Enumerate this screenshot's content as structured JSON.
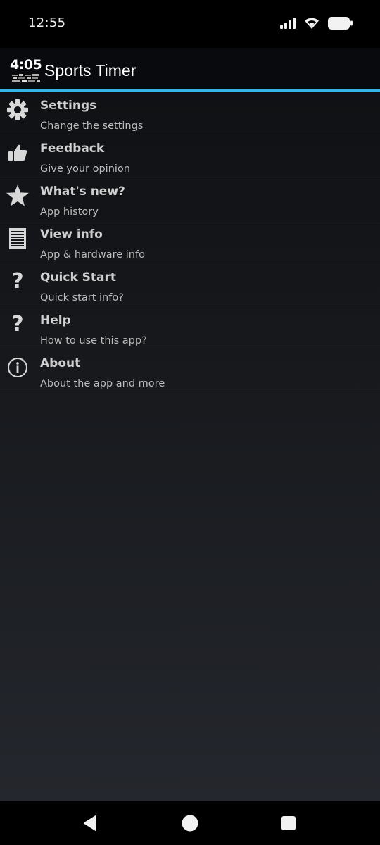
{
  "status_bar": {
    "time": "12:55",
    "icons": [
      "signal-icon",
      "wifi-icon",
      "battery-icon"
    ]
  },
  "app_bar": {
    "logo_digits": "4:05",
    "title": "Sports Timer",
    "accent_color": "#33b5e5"
  },
  "menu": {
    "items": [
      {
        "icon": "gear-icon",
        "title": "Settings",
        "subtitle": "Change the settings"
      },
      {
        "icon": "thumbs-up-icon",
        "title": "Feedback",
        "subtitle": "Give your opinion"
      },
      {
        "icon": "star-icon",
        "title": "What's new?",
        "subtitle": "App history"
      },
      {
        "icon": "document-lines-icon",
        "title": "View info",
        "subtitle": "App & hardware info"
      },
      {
        "icon": "question-mark-icon",
        "title": "Quick Start",
        "subtitle": "Quick start info?"
      },
      {
        "icon": "question-mark-icon",
        "title": "Help",
        "subtitle": "How to use this app?"
      },
      {
        "icon": "info-circle-icon",
        "title": "About",
        "subtitle": "About the app and more"
      }
    ],
    "question_glyph": "?"
  },
  "nav_bar": {
    "buttons": [
      "back-triangle-icon",
      "home-circle-icon",
      "recents-square-icon"
    ]
  }
}
